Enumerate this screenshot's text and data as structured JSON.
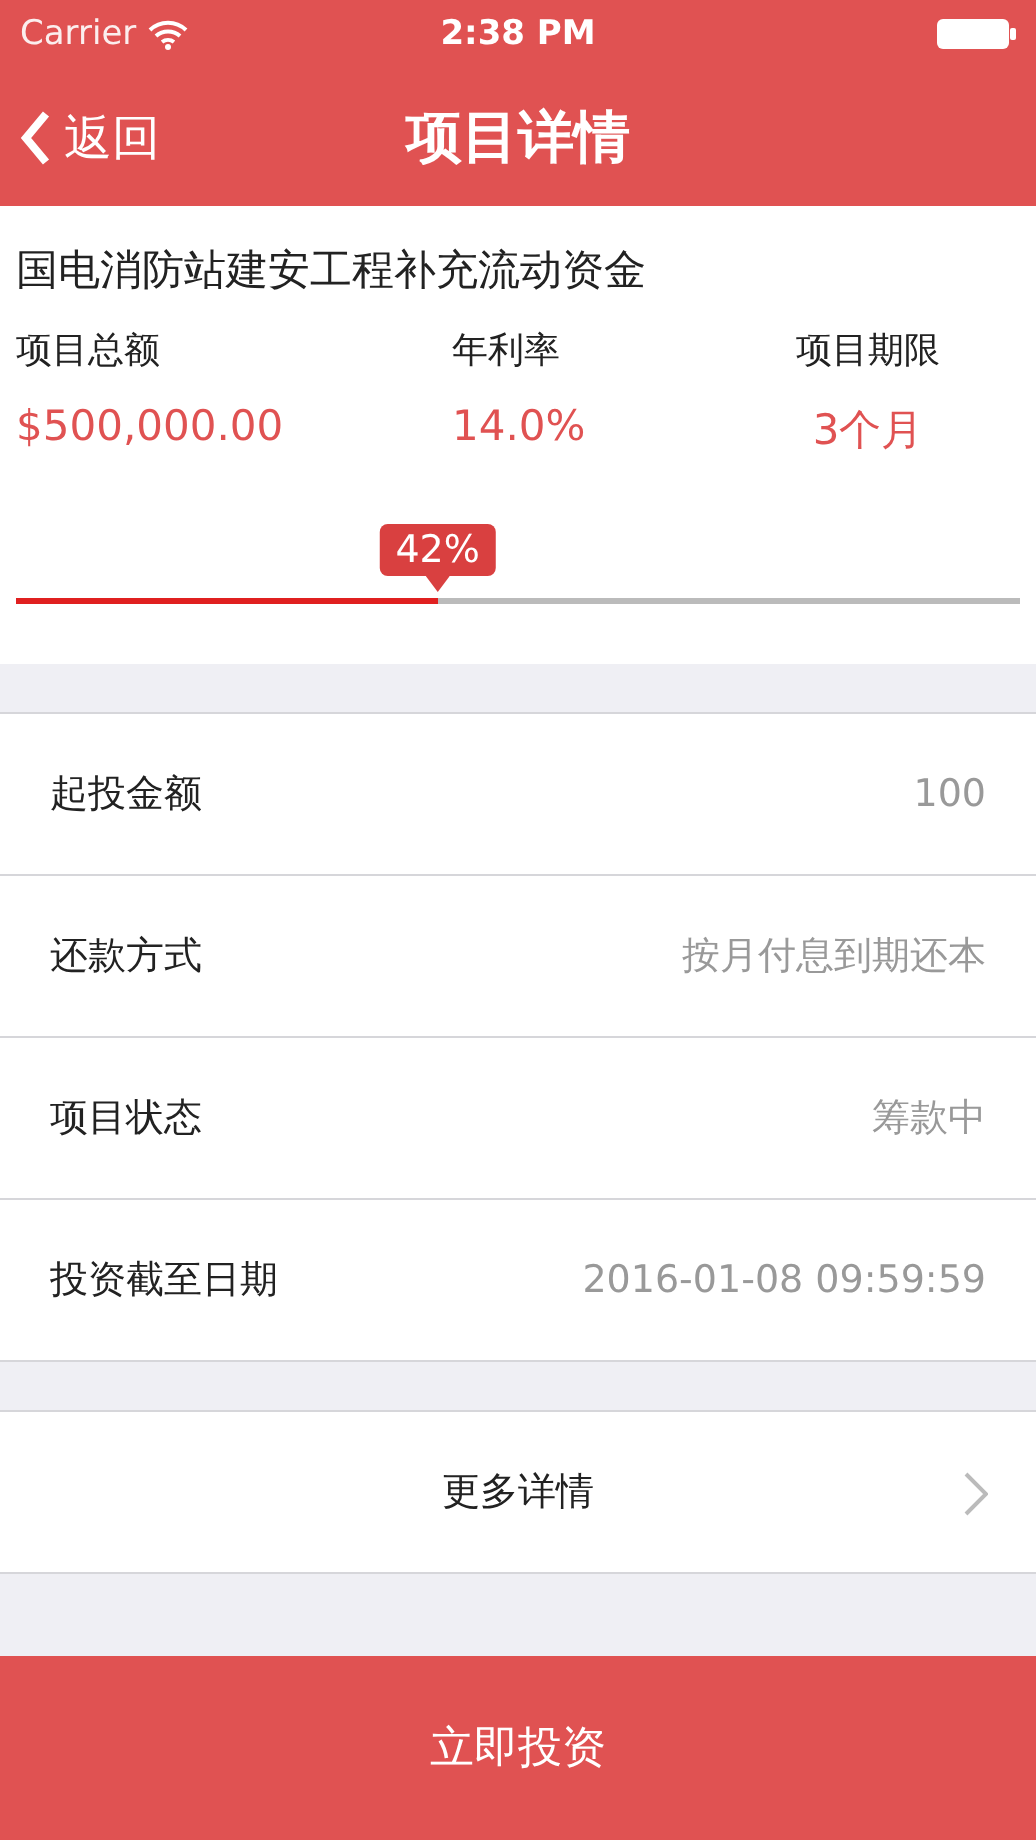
{
  "status_bar": {
    "carrier": "Carrier",
    "time": "2:38 PM"
  },
  "nav": {
    "back": "返回",
    "title": "项目详情"
  },
  "project": {
    "name": "国电消防站建安工程补充流动资金",
    "stats": [
      {
        "label": "项目总额",
        "value": "$500,000.00"
      },
      {
        "label": "年利率",
        "value": "14.0%"
      },
      {
        "label": "项目期限",
        "value": "3个月"
      }
    ],
    "progress": {
      "level": 0.42,
      "reading": "42%"
    }
  },
  "details": [
    {
      "label": "起投金额",
      "value": "100"
    },
    {
      "label": "还款方式",
      "value": "按月付息到期还本"
    },
    {
      "label": "项目状态",
      "value": "筹款中"
    },
    {
      "label": "投资截至日期",
      "value": "2016-01-08 09:59:59"
    }
  ],
  "more": {
    "label": "更多详情"
  },
  "invest_button": "立即投资"
}
